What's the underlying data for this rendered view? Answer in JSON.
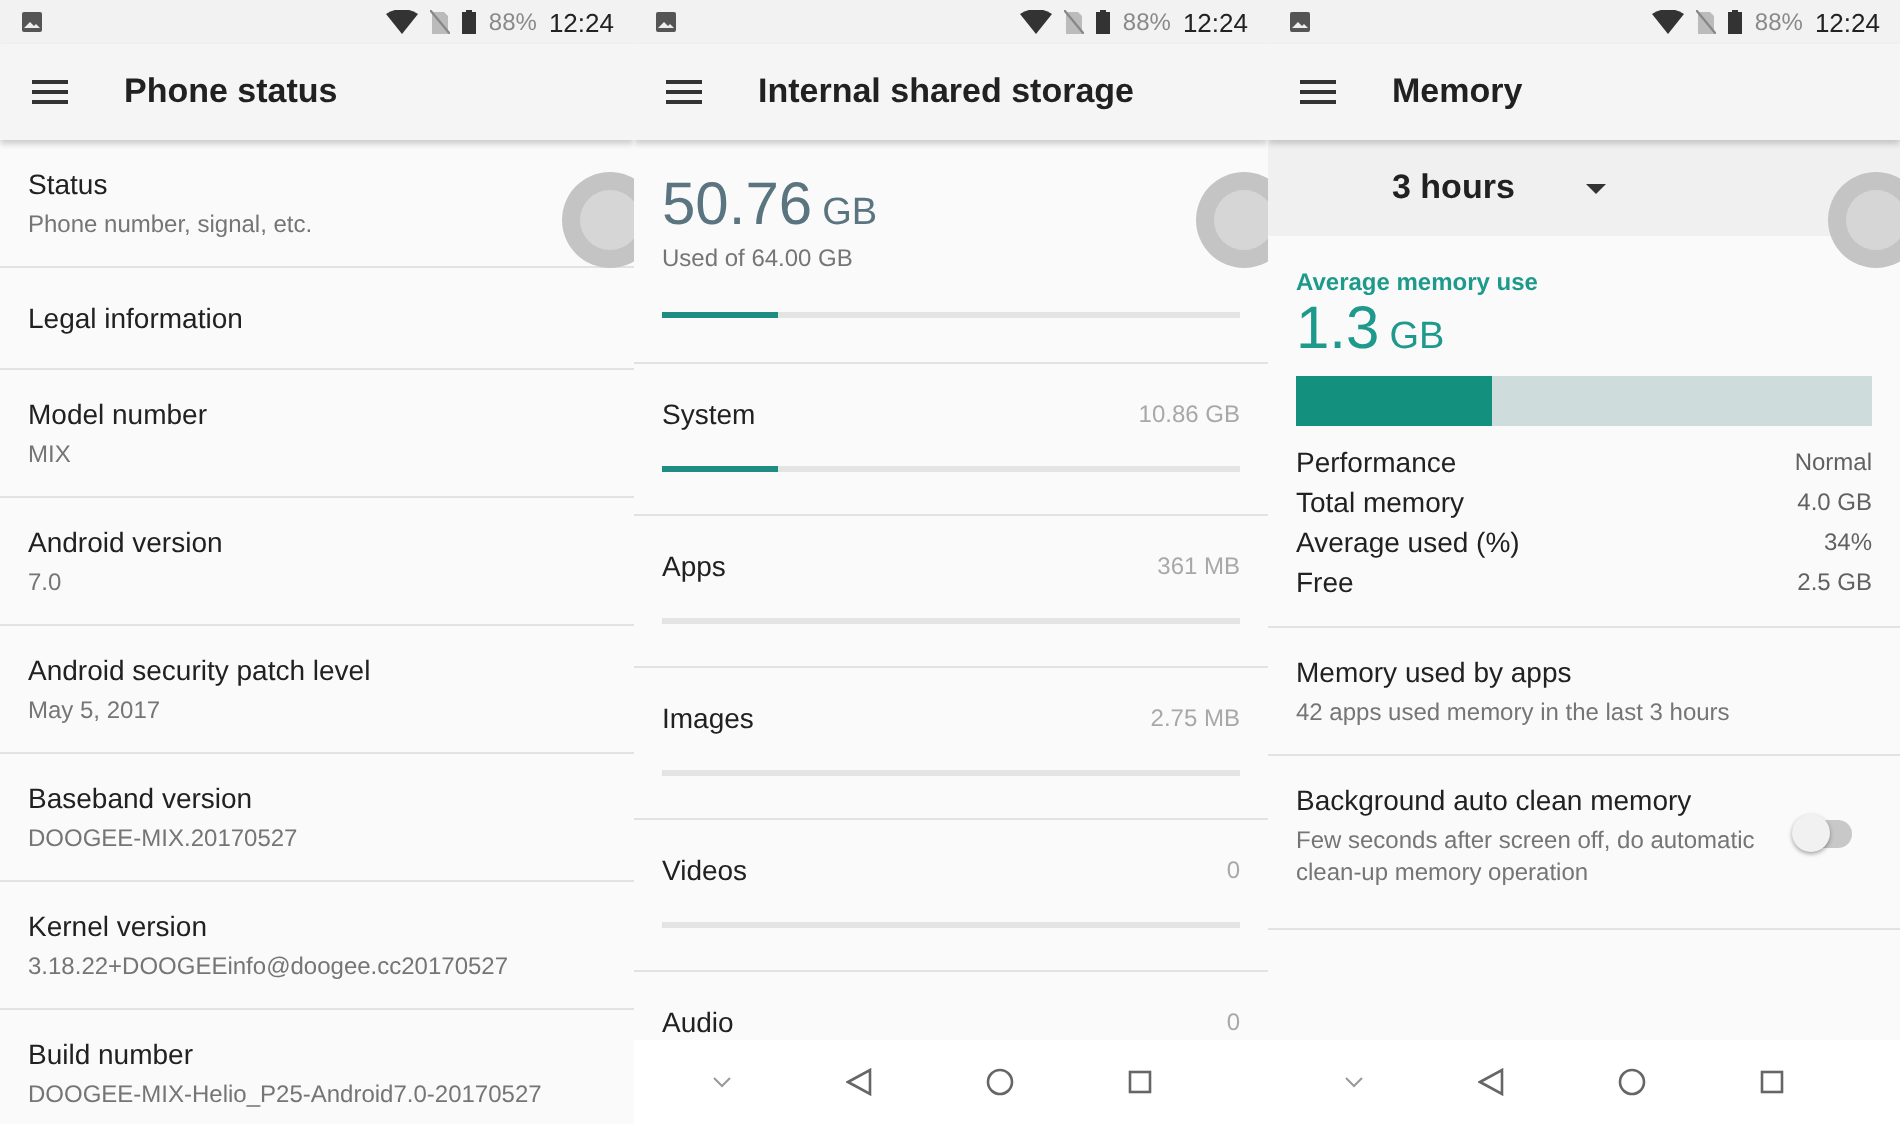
{
  "panels": [
    {
      "kind": "settings_list",
      "status_bar": {
        "battery": "88%",
        "time": "12:24"
      },
      "title": "Phone status",
      "items": [
        {
          "title": "Status",
          "subtitle": "Phone number, signal, etc."
        },
        {
          "title": "Legal information"
        },
        {
          "title": "Model number",
          "subtitle": "MIX"
        },
        {
          "title": "Android version",
          "subtitle": "7.0"
        },
        {
          "title": "Android security patch level",
          "subtitle": "May 5, 2017"
        },
        {
          "title": "Baseband version",
          "subtitle": "DOOGEE-MIX.20170527"
        },
        {
          "title": "Kernel version",
          "subtitle": "3.18.22+DOOGEEinfo@doogee.cc20170527"
        },
        {
          "title": "Build number",
          "subtitle": "DOOGEE-MIX-Helio_P25-Android7.0-20170527"
        }
      ]
    },
    {
      "kind": "storage",
      "status_bar": {
        "battery": "88%",
        "time": "12:24"
      },
      "title": "Internal shared storage",
      "summary": {
        "value": "50.76",
        "unit": "GB",
        "caption": "Used of 64.00 GB",
        "level": 0.2
      },
      "items": [
        {
          "label": "System",
          "value": "10.86 GB",
          "level": 0.2
        },
        {
          "label": "Apps",
          "value": "361 MB"
        },
        {
          "label": "Images",
          "value": "2.75 MB"
        },
        {
          "label": "Videos",
          "value": "0"
        },
        {
          "label": "Audio",
          "value": "0"
        }
      ]
    },
    {
      "kind": "memory",
      "status_bar": {
        "battery": "88%",
        "time": "12:24"
      },
      "title": "Memory",
      "period": "3 hours",
      "heading": "Average memory use",
      "average": {
        "value": "1.3",
        "unit": "GB",
        "level": 0.34
      },
      "stats": [
        {
          "label": "Performance",
          "value": "Normal"
        },
        {
          "label": "Total memory",
          "value": "4.0 GB"
        },
        {
          "label": "Average used (%)",
          "value": "34%"
        },
        {
          "label": "Free",
          "value": "2.5 GB"
        }
      ],
      "items": [
        {
          "kind": "link",
          "title": "Memory used by apps",
          "subtitle": "42 apps used memory in the last 3 hours"
        },
        {
          "kind": "toggle",
          "title": "Background auto clean memory",
          "subtitle": "Few seconds after screen off, do automatic clean-up memory operation",
          "on": false
        }
      ]
    }
  ]
}
